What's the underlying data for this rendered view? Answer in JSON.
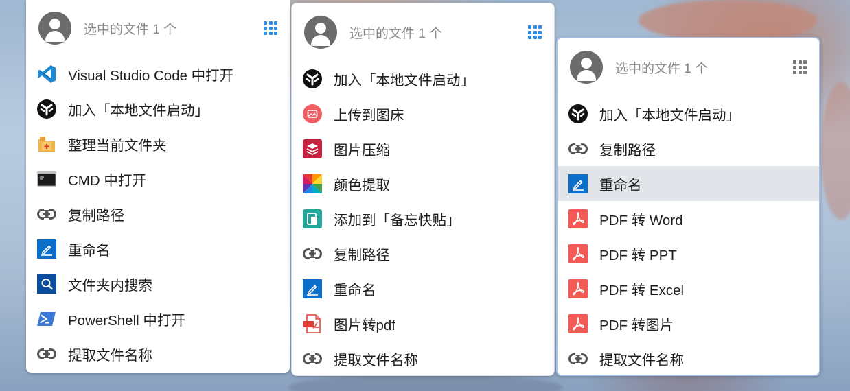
{
  "panels": [
    {
      "header": {
        "title": "选中的文件 1 个"
      },
      "items": [
        {
          "label": "Visual Studio Code 中打开",
          "icon": "vscode-icon"
        },
        {
          "label": "加入「本地文件启动」",
          "icon": "launcher-icon"
        },
        {
          "label": "整理当前文件夹",
          "icon": "folder-organize-icon"
        },
        {
          "label": "CMD 中打开",
          "icon": "cmd-icon"
        },
        {
          "label": "复制路径",
          "icon": "link-icon"
        },
        {
          "label": "重命名",
          "icon": "rename-icon"
        },
        {
          "label": "文件夹内搜索",
          "icon": "folder-search-icon"
        },
        {
          "label": "PowerShell 中打开",
          "icon": "powershell-icon"
        },
        {
          "label": "提取文件名称",
          "icon": "link-icon"
        }
      ]
    },
    {
      "header": {
        "title": "选中的文件 1 个"
      },
      "items": [
        {
          "label": "加入「本地文件启动」",
          "icon": "launcher-icon"
        },
        {
          "label": "上传到图床",
          "icon": "image-upload-icon"
        },
        {
          "label": "图片压缩",
          "icon": "image-compress-icon"
        },
        {
          "label": "颜色提取",
          "icon": "color-picker-icon"
        },
        {
          "label": "添加到「备忘快贴」",
          "icon": "clipboard-icon"
        },
        {
          "label": "复制路径",
          "icon": "link-icon"
        },
        {
          "label": "重命名",
          "icon": "rename-icon"
        },
        {
          "label": "图片转pdf",
          "icon": "pdf-icon"
        },
        {
          "label": "提取文件名称",
          "icon": "link-icon"
        }
      ]
    },
    {
      "header": {
        "title": "选中的文件 1 个"
      },
      "items": [
        {
          "label": "加入「本地文件启动」",
          "icon": "launcher-icon"
        },
        {
          "label": "复制路径",
          "icon": "link-icon"
        },
        {
          "label": "重命名",
          "icon": "rename-icon",
          "active": true
        },
        {
          "label": "PDF 转 Word",
          "icon": "acrobat-icon"
        },
        {
          "label": "PDF 转 PPT",
          "icon": "acrobat-icon"
        },
        {
          "label": "PDF 转 Excel",
          "icon": "acrobat-icon"
        },
        {
          "label": "PDF 转图片",
          "icon": "acrobat-icon"
        },
        {
          "label": "提取文件名称",
          "icon": "link-icon"
        }
      ]
    }
  ],
  "colors": {
    "accent": "#2b8be6",
    "active_row": "#e1e4e8",
    "header_text": "#8a8a8a"
  }
}
